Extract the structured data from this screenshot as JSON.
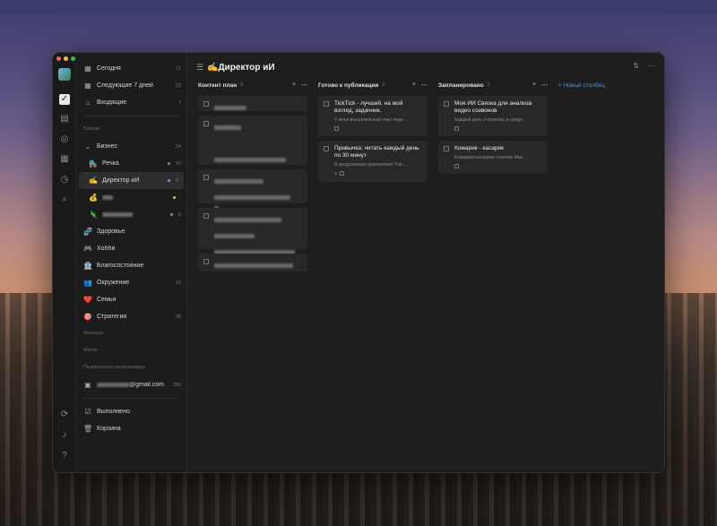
{
  "sidebar": {
    "smart_lists": [
      {
        "icon": "calendar-today-icon",
        "glyph": "▦",
        "label": "Сегодня",
        "count": "11"
      },
      {
        "icon": "calendar-week-icon",
        "glyph": "▦",
        "label": "Следующие 7 дней",
        "count": "13"
      },
      {
        "icon": "inbox-icon",
        "glyph": "⌂",
        "label": "Входящие",
        "count": "7"
      }
    ],
    "lists_heading": "Списки",
    "folder": {
      "label": "Бизнес",
      "count": "24"
    },
    "folder_items": [
      {
        "emoji": "🛼",
        "label": "Речка",
        "count": "10",
        "dot_color": "#4a8fe0"
      },
      {
        "emoji": "✍️",
        "label": "Директор иИ",
        "count": "9",
        "dot_color": "#9a7de0"
      },
      {
        "emoji": "💰",
        "label": "",
        "count": "",
        "dot_color": "#e6c43c"
      },
      {
        "emoji": "🦎",
        "label": "",
        "count": "5",
        "dot_color": "#3cc46a"
      }
    ],
    "lists": [
      {
        "emoji": "🧬",
        "label": "Здоровье",
        "count": ""
      },
      {
        "emoji": "🎮",
        "label": "Хобби",
        "count": ""
      },
      {
        "emoji": "🏦",
        "label": "Благосостояние",
        "count": ""
      },
      {
        "emoji": "👥",
        "label": "Окружение",
        "count": "15"
      },
      {
        "emoji": "❤️",
        "label": "Семья",
        "count": ""
      },
      {
        "emoji": "🎯",
        "label": "Стратегия",
        "count": "20"
      }
    ],
    "filters_heading": "Фильтры",
    "tags_heading": "Метки",
    "calendar_heading": "Подписаться на календарь",
    "calendar_account": {
      "label_suffix": "@gmail.com",
      "count": "255"
    },
    "completed": "Выполнено",
    "trash": "Корзина"
  },
  "board": {
    "title_emoji": "✍️",
    "title": "Директор иИ",
    "new_column": "+ Новый столбец",
    "columns": [
      {
        "name": "Контент план",
        "count": "5"
      },
      {
        "name": "Готово к публикации",
        "count": "2"
      },
      {
        "name": "Запланировано",
        "count": "2"
      }
    ],
    "cards": {
      "ready": [
        {
          "title": "TickTick - лучший, на мой взгляд, задачник.",
          "desc": "У меня внушительный опыт веде..."
        },
        {
          "title": "Привычка: читать каждый день по 30 минут",
          "desc": "В продолжение приложения Тик-..."
        }
      ],
      "planned": [
        {
          "title": "Моя ИИ Связка для анализа видео созвонов",
          "desc": "Каждый день я провожу, в средн..."
        },
        {
          "title": "Комарик - касарик",
          "desc": "Комарики-касарики отметив Мак..."
        }
      ]
    }
  },
  "colors": {
    "traffic_red": "#fe5f57",
    "traffic_yellow": "#febc2e",
    "traffic_green": "#28c840",
    "accent": "#5a8fd8"
  }
}
